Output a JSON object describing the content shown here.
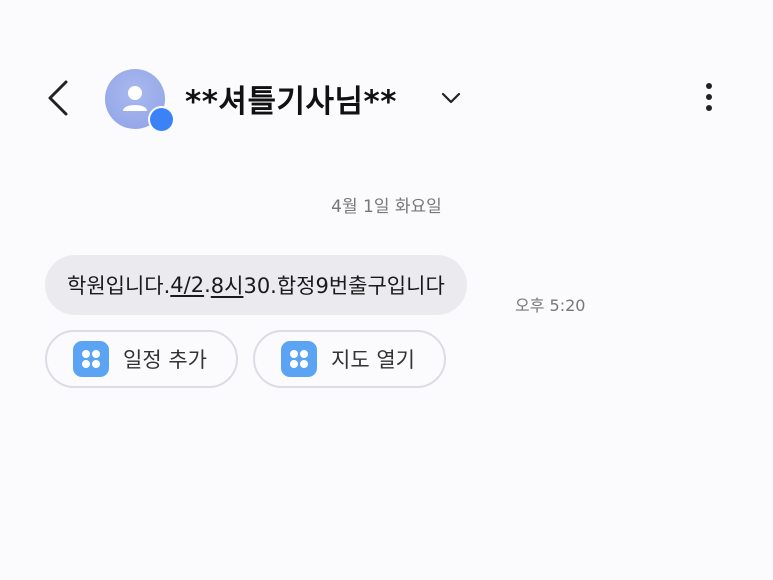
{
  "header": {
    "back_icon": "chevron-left-icon",
    "avatar_icon": "person-icon",
    "badge_icon": "chat-bubble-icon",
    "contact_name": "**셔틀기사님**",
    "expand_icon": "chevron-down-icon",
    "more_icon": "more-vertical-icon"
  },
  "conversation": {
    "date_separator": "4월 1일 화요일",
    "messages": [
      {
        "parts": [
          {
            "text": "학원입니다.",
            "link": false
          },
          {
            "text": "4/2",
            "link": true
          },
          {
            "text": ".",
            "link": false
          },
          {
            "text": "8시",
            "link": true
          },
          {
            "text": "30.합정9번출구입니다",
            "link": false
          }
        ],
        "time": "오후 5:20"
      }
    ],
    "suggested_actions": [
      {
        "label": "일정 추가",
        "icon": "app-grid-icon"
      },
      {
        "label": "지도 열기",
        "icon": "app-grid-icon"
      }
    ]
  },
  "colors": {
    "background": "#fbfbfe",
    "bubble": "#ebebef",
    "avatar": "#9aaceb",
    "badge": "#3b82f6",
    "chip_icon": "#5ba4f3"
  }
}
